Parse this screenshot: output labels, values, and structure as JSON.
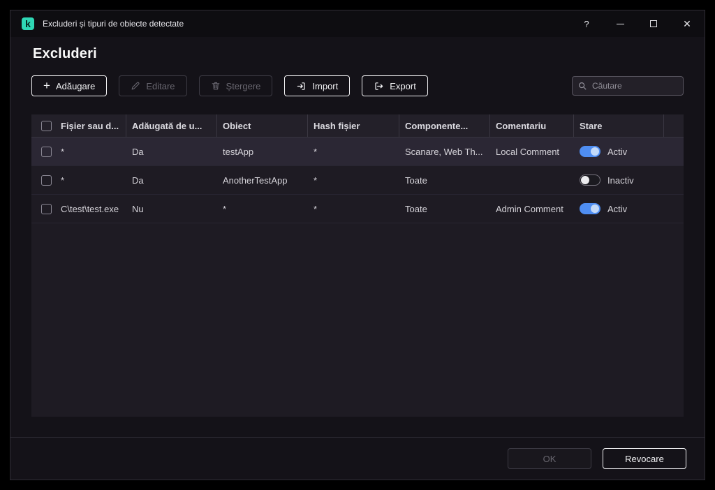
{
  "window": {
    "title": "Excluderi și tipuri de obiecte detectate",
    "controls": {
      "help": "?",
      "close": "✕"
    }
  },
  "page": {
    "title": "Excluderi"
  },
  "toolbar": {
    "add": "Adăugare",
    "edit": "Editare",
    "delete": "Ștergere",
    "import": "Import",
    "export": "Export",
    "search_placeholder": "Căutare"
  },
  "table": {
    "headers": [
      "Fișier sau d...",
      "Adăugată de u...",
      "Obiect",
      "Hash fișier",
      "Componente...",
      "Comentariu",
      "Stare"
    ],
    "rows": [
      {
        "file": "*",
        "added": "Da",
        "object": "testApp",
        "hash": "*",
        "components": "Scanare, Web Th...",
        "comment": "Local Comment",
        "state": "Activ",
        "active": true,
        "selected": true
      },
      {
        "file": "*",
        "added": "Da",
        "object": "AnotherTestApp",
        "hash": "*",
        "components": "Toate",
        "comment": "",
        "state": "Inactiv",
        "active": false
      },
      {
        "file": "C\\test\\test.exe",
        "added": "Nu",
        "object": "*",
        "hash": "*",
        "components": "Toate",
        "comment": "Admin Comment",
        "state": "Activ",
        "active": true
      }
    ]
  },
  "footer": {
    "ok": "OK",
    "cancel": "Revocare"
  },
  "colors": {
    "brand_green": "#2fd7b5",
    "toggle_on_blue": "#4f8ef2",
    "row_selected": "#2b2734"
  }
}
